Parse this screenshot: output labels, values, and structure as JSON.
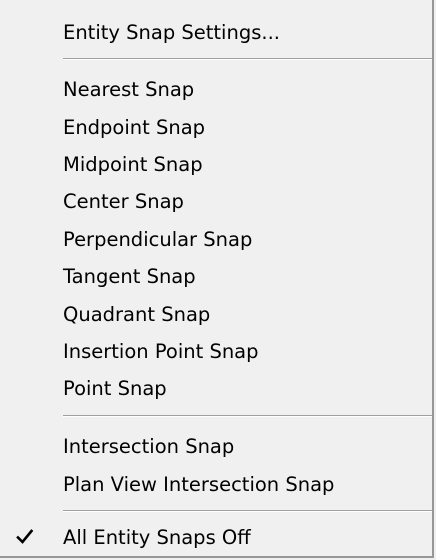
{
  "menu": {
    "items": [
      {
        "label": "Entity Snap Settings...",
        "checked": false
      },
      {
        "label": "Nearest Snap",
        "checked": false
      },
      {
        "label": "Endpoint Snap",
        "checked": false
      },
      {
        "label": "Midpoint Snap",
        "checked": false
      },
      {
        "label": "Center Snap",
        "checked": false
      },
      {
        "label": "Perpendicular Snap",
        "checked": false
      },
      {
        "label": "Tangent Snap",
        "checked": false
      },
      {
        "label": "Quadrant Snap",
        "checked": false
      },
      {
        "label": "Insertion Point Snap",
        "checked": false
      },
      {
        "label": "Point Snap",
        "checked": false
      },
      {
        "label": "Intersection Snap",
        "checked": false
      },
      {
        "label": "Plan View Intersection Snap",
        "checked": false
      },
      {
        "label": "All Entity Snaps Off",
        "checked": true
      }
    ],
    "check_icon": "checkmark-icon"
  }
}
